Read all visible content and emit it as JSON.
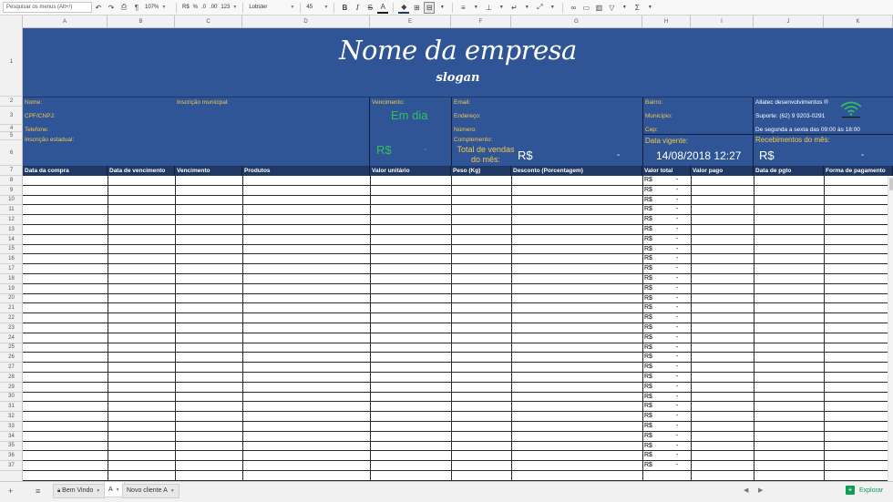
{
  "toolbar": {
    "menu_search_placeholder": "Pesquisar os menus (Alt+/)",
    "zoom": "107%",
    "currency_format": "R$",
    "percent_format": "%",
    "decrease_decimals": ".0",
    "increase_decimals": ".00",
    "more_formats": "123",
    "font_name": "Lobster",
    "font_size": "45",
    "bold": "B",
    "italic": "I",
    "strikethrough": "S",
    "text_color": "A"
  },
  "columns": [
    "A",
    "B",
    "C",
    "D",
    "E",
    "F",
    "G",
    "H",
    "I",
    "J",
    "K"
  ],
  "rows": [
    "1",
    "2",
    "3",
    "4",
    "5",
    "6",
    "7",
    "8",
    "9",
    "10",
    "11",
    "12",
    "13",
    "14",
    "15",
    "16",
    "17",
    "18",
    "19",
    "20",
    "21",
    "22",
    "23",
    "24",
    "25",
    "26",
    "27",
    "28",
    "29",
    "30",
    "31",
    "32",
    "33",
    "34",
    "35",
    "36",
    "37"
  ],
  "banner": {
    "company_name": "Nome da empresa",
    "slogan": "slogan"
  },
  "info": {
    "nome": "Nome:",
    "inscricao_municipal": "Inscrição municipal:",
    "cpf_cnpj": "CPF/CNPJ:",
    "telefone": "Telefone:",
    "inscricao_estadual": "Inscrição estadual:",
    "vencimento": "Vencimento:",
    "em_dia": "Em dia",
    "venc_currency": "R$",
    "venc_dash": "-",
    "email": "Email:",
    "endereco": "Endereço:",
    "numero": "Número:",
    "complemento": "Complemento:",
    "total_vendas": "Total de vendas do mês:",
    "total_vendas_currency": "R$",
    "total_vendas_dash": "-",
    "bairro": "Bairro:",
    "municipio": "Município:",
    "cep": "Cep:",
    "data_vigente": "Data vigente:",
    "data_vigente_value": "14/08/2018 12:27",
    "company": "Allatec desenvolvimentos ®",
    "suporte": "Suporte: (62) 9 9203-0291",
    "horario": "De segunda a sexta das 09:00 às 18:00",
    "recebimentos": "Recebimentos do mês:",
    "receb_currency": "R$",
    "receb_dash": "-"
  },
  "table_headers": [
    "Data da compra",
    "Data de vencimento",
    "Vencimento",
    "Produtos",
    "Valor unitário",
    "Peso (Kg)",
    "Desconto (Porcentagem)",
    "Valor total",
    "Valor pago",
    "Data de pgto",
    "Forma de pagamento"
  ],
  "row_currency": "R$",
  "row_dash": "-",
  "sheet_tabs": {
    "add": "+",
    "list": "≡",
    "bem_vindo": "Bem Vindo",
    "a": "A",
    "novo_cliente": "Novo cliente A",
    "explore": "Explorar"
  }
}
